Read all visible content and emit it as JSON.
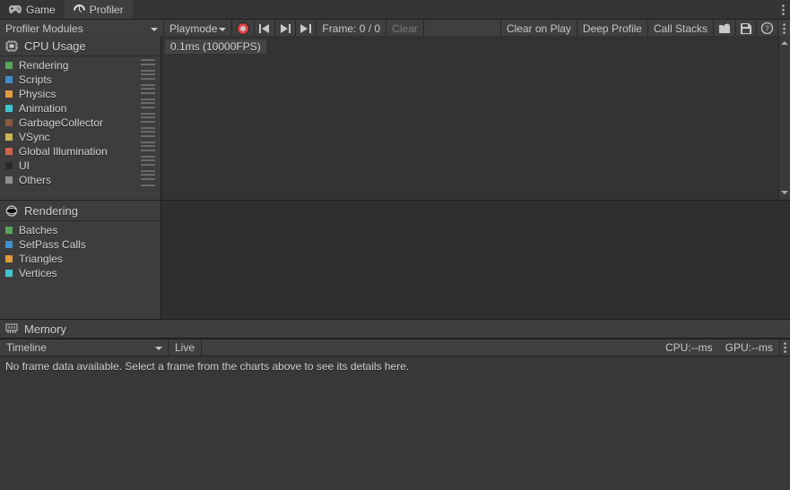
{
  "tabs": {
    "game": "Game",
    "profiler": "Profiler"
  },
  "toolbar": {
    "modules_label": "Profiler Modules",
    "playmode_label": "Playmode",
    "frame_label": "Frame: 0 / 0",
    "clear": "Clear",
    "clear_on_play": "Clear on Play",
    "deep_profile": "Deep Profile",
    "call_stacks": "Call Stacks"
  },
  "cpu": {
    "title": "CPU Usage",
    "overlay": "0.1ms (10000FPS)",
    "items": [
      {
        "label": "Rendering",
        "color": "#59A55C",
        "handle": true
      },
      {
        "label": "Scripts",
        "color": "#3F90C8",
        "handle": true
      },
      {
        "label": "Physics",
        "color": "#E29A3D",
        "handle": true
      },
      {
        "label": "Animation",
        "color": "#3EC4CE",
        "handle": true
      },
      {
        "label": "GarbageCollector",
        "color": "#8C5A3E",
        "handle": true
      },
      {
        "label": "VSync",
        "color": "#C9B84E",
        "handle": true
      },
      {
        "label": "Global Illumination",
        "color": "#D26546",
        "handle": true
      },
      {
        "label": "UI",
        "color": "#2A2A2A",
        "handle": true
      },
      {
        "label": "Others",
        "color": "#8E8E8E",
        "handle": true
      }
    ]
  },
  "rendering": {
    "title": "Rendering",
    "items": [
      {
        "label": "Batches",
        "color": "#59A55C"
      },
      {
        "label": "SetPass Calls",
        "color": "#3F90C8"
      },
      {
        "label": "Triangles",
        "color": "#E29A3D"
      },
      {
        "label": "Vertices",
        "color": "#3EC4CE"
      }
    ]
  },
  "memory": {
    "title": "Memory"
  },
  "detail": {
    "mode": "Timeline",
    "live": "Live",
    "cpu": "CPU:--ms",
    "gpu": "GPU:--ms",
    "message": "No frame data available. Select a frame from the charts above to see its details here."
  }
}
